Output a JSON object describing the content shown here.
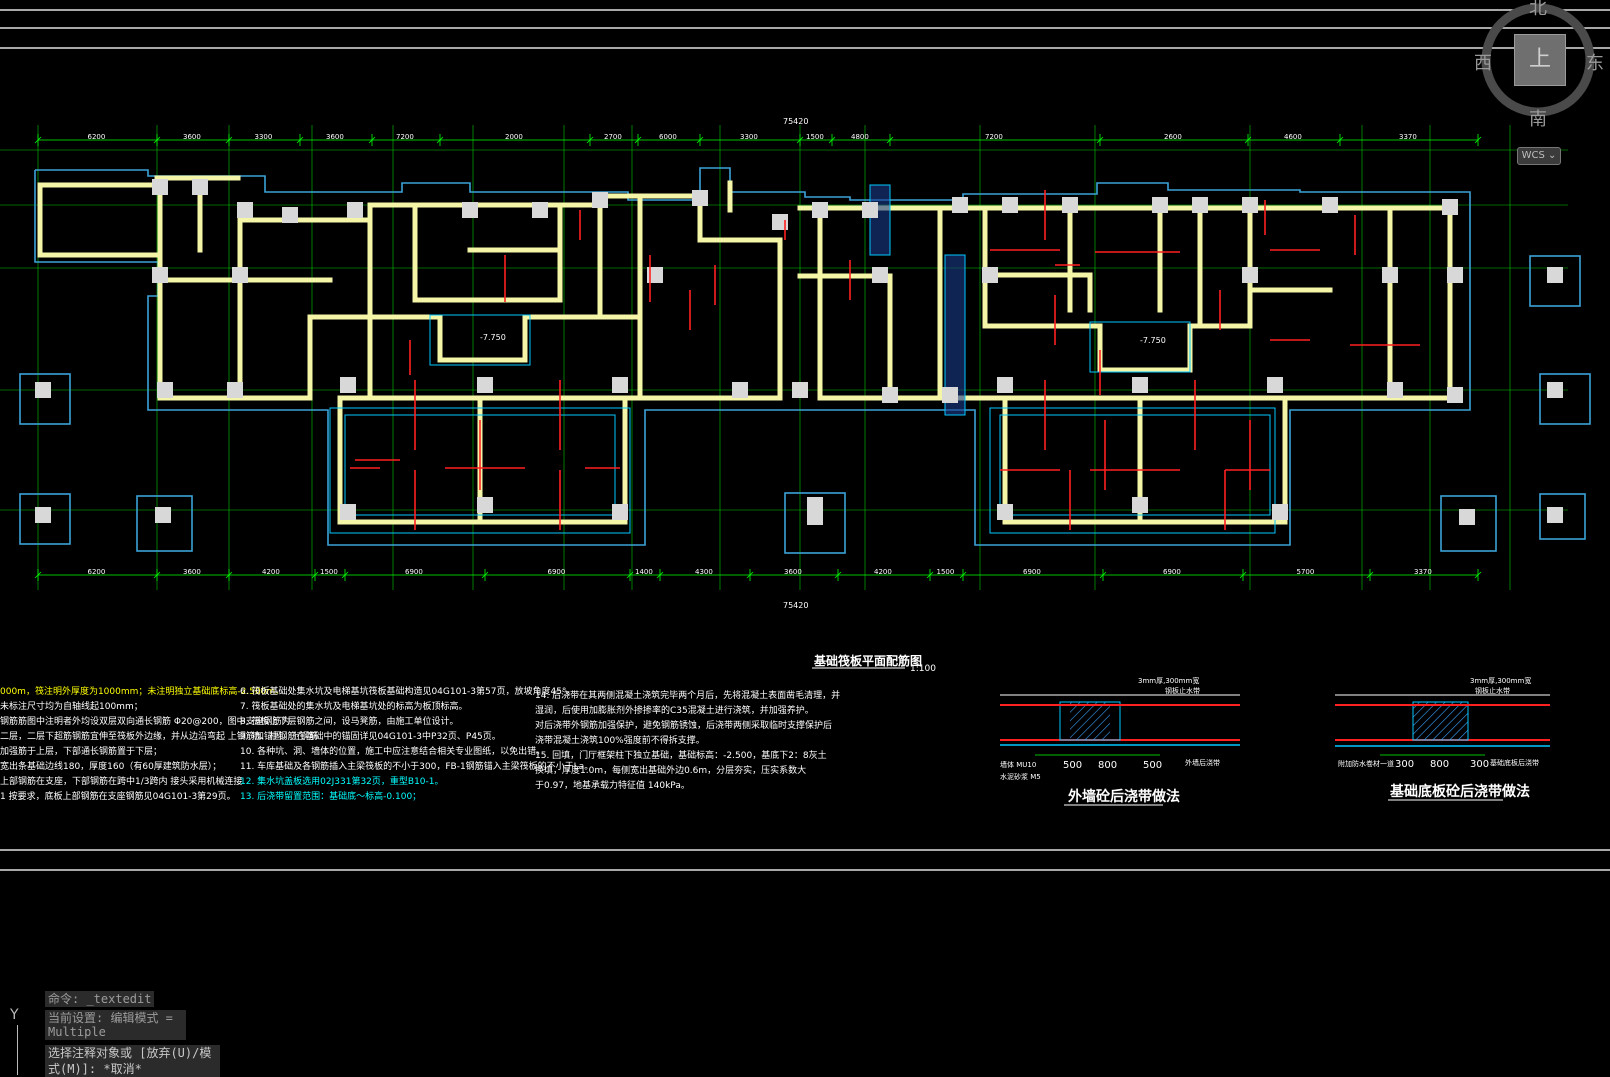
{
  "viewcube": {
    "north": "北",
    "south": "南",
    "east": "东",
    "west": "西",
    "face": "上",
    "wcs_label": "WCS"
  },
  "drawing": {
    "main_title": "基础筏板平面配筋图",
    "main_scale": "1:100",
    "detail1_title": "外墙砼后浇带做法",
    "detail2_title": "基础底板砼后浇带做法",
    "top_dims": [
      "6200",
      "3600",
      "3300",
      "3600",
      "7200",
      "2000",
      "2700",
      "6000",
      "3300",
      "1500",
      "4800",
      "7200",
      "2600",
      "4600",
      "3370"
    ],
    "overall_dim": "75420",
    "bottom_dims": [
      "6200",
      "3600",
      "4200",
      "1500",
      "6900",
      "6900",
      "1400",
      "4300",
      "3600",
      "4200",
      "1500",
      "6900",
      "6900",
      "5700",
      "3370"
    ],
    "detail1_dims": [
      "500",
      "800",
      "500"
    ],
    "detail2_dims": [
      "300",
      "800",
      "300"
    ],
    "detail1_labels": [
      "3mm厚,300mm宽",
      "钢板止水带",
      "外墙后浇带",
      "水泥砂浆 M5",
      "墙体 MU10"
    ],
    "detail2_labels": [
      "3mm厚,300mm宽",
      "钢板止水带",
      "基础底板后浇带",
      "附加防水卷材一道"
    ],
    "levels": [
      "-7.750",
      "-7.750"
    ]
  },
  "notes": {
    "col1": [
      "000m，筏注明外厚度为1000mm；未注明独立基础底标高-2.500m。",
      "未标注尺寸均为自轴线起100mm；",
      "钢筋筋图中注明者外均设双层双向通长钢筋 Φ20@200，图中支座钢筋为",
      "二层，二层下超筋钢筋宜伸至筏板外边缘，并从边沿弯起 上钢筋加锚固，上钢筋",
      "加强筋于上层，下部通长钢筋置于下层；",
      "宽出条基础边线180，厚度160（有60厚建筑防水层）；",
      "上部钢筋在支座，下部钢筋在跨中1/3跨内 接头采用机械连接",
      "1  按要求，底板上部钢筋在支座钢筋见04G101-3第29页。"
    ],
    "col2": [
      "6. 筏板基础处集水坑及电梯基坑筏板基础构造见04G101-3第57页，放坡角度45°。",
      "7. 筏板基础处的集水坑及电梯基坑处的标高为板顶标高。",
      "8. 筏板上下层钢筋之间，设马凳筋，由施工单位设计。",
      "9. 墙、柱钢筋在基础中的锚固详见04G101-3中P32页、P45页。",
      "10. 各种坑、洞、墙体的位置，施工中应注意结合相关专业图纸，以免出错。",
      "11. 车库基础及各钢筋插入主梁筏板的不小于300，FB-1钢筋锚入主梁筏板的不小于La。",
      "12. 集水坑盖板选用02J331第32页，重型B10-1。",
      "13. 后浇带留置范围：基础底～标高-0.100；"
    ],
    "col3": [
      "14. 后浇带在其两侧混凝土浇筑完毕两个月后，先将混凝土表面凿毛清理，并",
      "湿润，后使用加膨胀剂外掺掺率的C35混凝土进行浇筑，并加强养护。",
      "对后浇带外钢筋加强保护，避免钢筋锈蚀，后浇带两侧采取临时支撑保护后",
      "浇带混凝土浇筑100%强度前不得拆支撑。",
      "15. 回填，门厅框架柱下独立基础，基础标高：-2.500，基底下2：8灰土",
      "换填，厚度1.0m，每侧宽出基础外边0.6m，分层夯实，压实系数大",
      "于0.97，地基承载力特征值 140kPa。"
    ]
  },
  "command": {
    "history_line": "命令: _textedit",
    "history_setting": "当前设置: 编辑模式 = Multiple",
    "prompt_line1": "选择注释对象或 [放弃(U)/模",
    "prompt_line2": "式(M)]: *取消*"
  },
  "ucs": {
    "y_label": "Y"
  },
  "colors": {
    "wall": "#f5f5a8",
    "outline": "#3aa3d8",
    "dim": "#00ff00",
    "rebar": "#ff2020",
    "column": "#d8d8d8",
    "text": "#ffffff"
  }
}
